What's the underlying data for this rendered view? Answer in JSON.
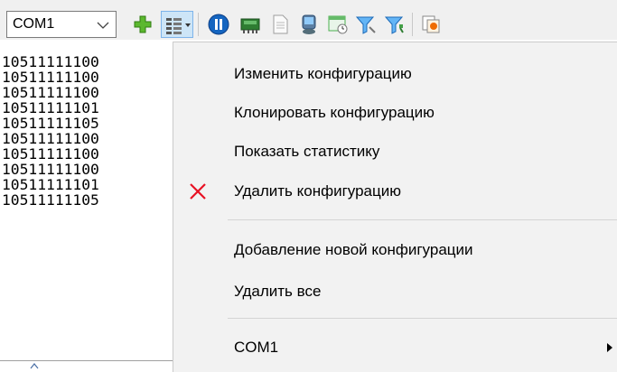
{
  "toolbar": {
    "port_value": "COM1",
    "icons": [
      "add-icon",
      "config-menu-icon",
      "pause-icon",
      "device-icon",
      "document-icon",
      "monitor-icon",
      "schedule-icon",
      "filter-icon",
      "filter-add-icon",
      "export-icon"
    ]
  },
  "list": {
    "rows": [
      "10511111100",
      "10511111100",
      "10511111100",
      "10511111101",
      "10511111105",
      "10511111100",
      "10511111100",
      "10511111100",
      "10511111101",
      "10511111105"
    ]
  },
  "menu": {
    "items": [
      {
        "label": "Изменить конфигурацию"
      },
      {
        "label": "Клонировать конфигурацию"
      },
      {
        "label": "Показать статистику"
      },
      {
        "label": "Удалить конфигурацию",
        "icon": "delete-x-icon"
      },
      {
        "label": "Добавление новой конфигурации"
      },
      {
        "label": "Удалить все"
      },
      {
        "label": "COM1",
        "submenu": true
      }
    ]
  },
  "colors": {
    "toolbar_bg": "#f0f0f0",
    "menu_bg": "#f2f2f2",
    "delete_icon": "#e81123",
    "pressed_bg": "#cde5f7"
  }
}
